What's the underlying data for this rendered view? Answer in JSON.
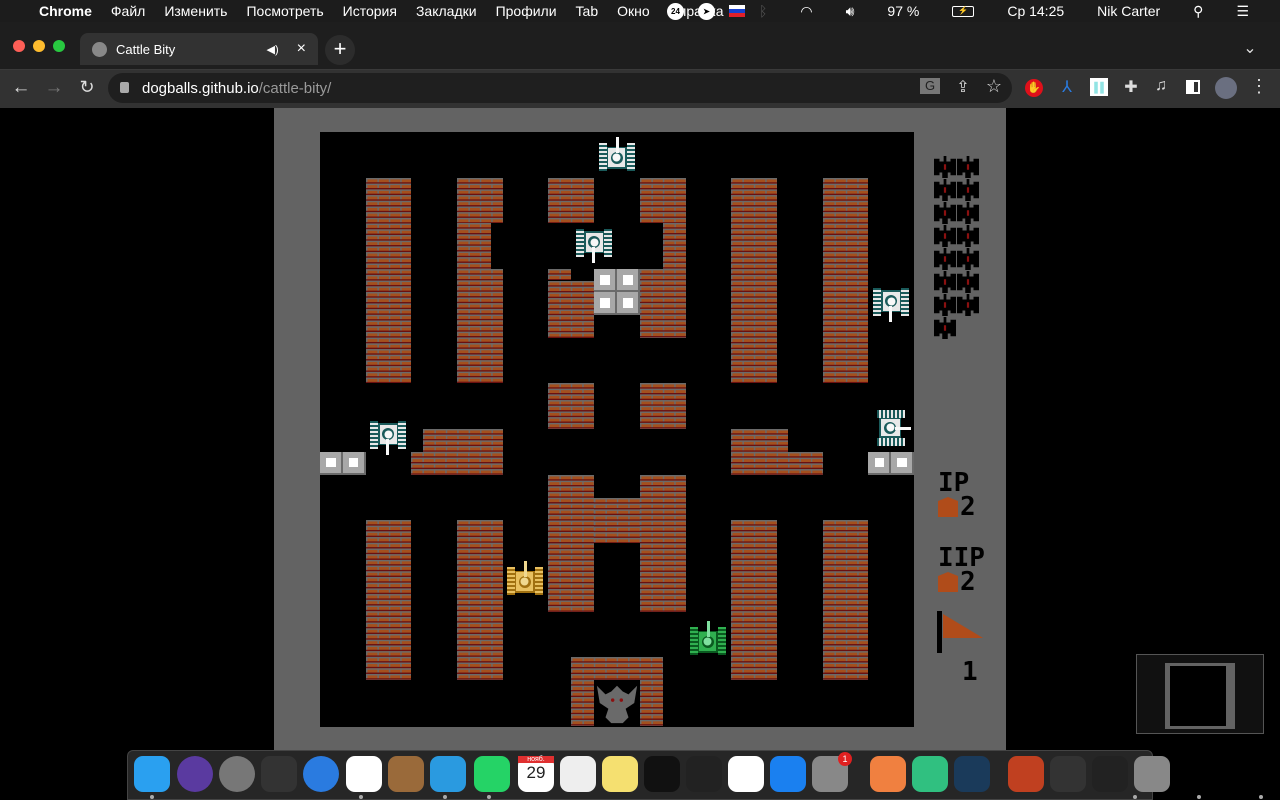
{
  "menubar": {
    "apple": "",
    "app": "Chrome",
    "items": [
      "Файл",
      "Изменить",
      "Посмотреть",
      "История",
      "Закладки",
      "Профили",
      "Tab",
      "Окно",
      "Справка"
    ],
    "battery": "97 %",
    "clock": "Ср 14:25",
    "user": "Nik Carter",
    "badge24": "24"
  },
  "tab": {
    "title": "Cattle Bity",
    "close": "×",
    "new": "+"
  },
  "address": {
    "host": "dogballs.github.io",
    "path": "/cattle-bity/"
  },
  "game": {
    "colors": {
      "brick": "#a4501e",
      "steel": "#a8a8a8",
      "panel": "#636363",
      "player1": "#e0b040",
      "player2": "#20a040",
      "enemy": "#e0e0e0"
    },
    "enemies_remaining": 15,
    "p1": {
      "label": "IP",
      "lives": "2"
    },
    "p2": {
      "label": "IIP",
      "lives": "2"
    },
    "stage": "1",
    "tanks": [
      {
        "type": "enemy",
        "dir": "up"
      },
      {
        "type": "enemy",
        "dir": "down"
      },
      {
        "type": "enemy",
        "dir": "down"
      },
      {
        "type": "enemy",
        "dir": "down"
      },
      {
        "type": "enemy",
        "dir": "right"
      },
      {
        "type": "player1",
        "dir": "up"
      },
      {
        "type": "player2",
        "dir": "up"
      }
    ]
  },
  "dock": {
    "calendar_month": "нояб.",
    "calendar_day": "29",
    "settings_badge": "1",
    "apps": [
      "Finder",
      "Siri",
      "Launchpad",
      "Mission Control",
      "Safari",
      "Chrome",
      "Contacts",
      "Telegram",
      "WhatsApp",
      "Calendar",
      "TextEdit",
      "Notes",
      "Xmind",
      "Alien",
      "Music",
      "App Store",
      "System Preferences",
      "Yandex 24",
      "24",
      "Steam",
      "Preview",
      "Activity",
      "Window",
      "Trash"
    ]
  }
}
